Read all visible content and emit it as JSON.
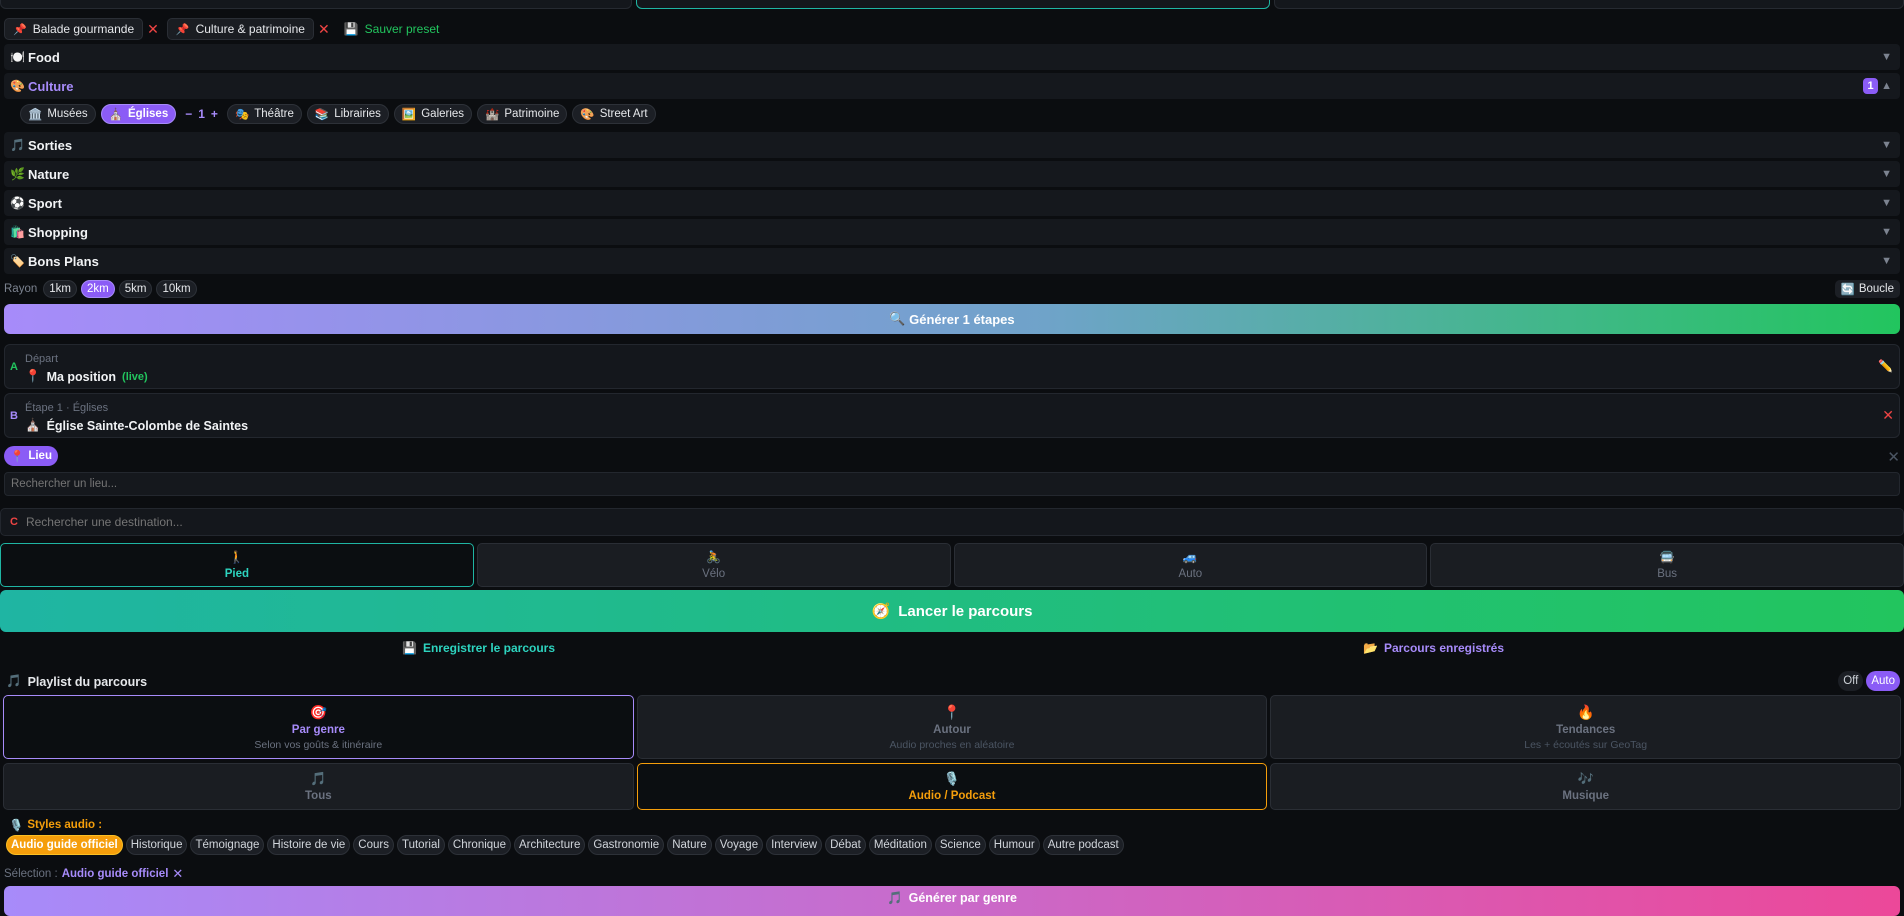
{
  "presets": {
    "items": [
      {
        "icon": "📌",
        "label": "Balade gourmande",
        "remove": "✕"
      },
      {
        "icon": "📌",
        "label": "Culture & patrimoine",
        "remove": "✕"
      }
    ],
    "save_icon": "💾",
    "save_label": "Sauver preset"
  },
  "categories": [
    {
      "icon": "🍽️",
      "label": "Food",
      "chevron": "▼"
    },
    {
      "icon": "🎨",
      "label": "Culture",
      "chevron": "▲",
      "count": "1"
    },
    {
      "icon": "🎵",
      "label": "Sorties",
      "chevron": "▼"
    },
    {
      "icon": "🌿",
      "label": "Nature",
      "chevron": "▼"
    },
    {
      "icon": "⚽",
      "label": "Sport",
      "chevron": "▼"
    },
    {
      "icon": "🛍️",
      "label": "Shopping",
      "chevron": "▼"
    },
    {
      "icon": "🏷️",
      "label": "Bons Plans",
      "chevron": "▼"
    }
  ],
  "subcategories": {
    "items": [
      {
        "icon": "🏛️",
        "label": "Musées"
      },
      {
        "icon": "⛪",
        "label": "Églises"
      },
      {
        "icon": "🎭",
        "label": "Théâtre"
      },
      {
        "icon": "📚",
        "label": "Librairies"
      },
      {
        "icon": "🖼️",
        "label": "Galeries"
      },
      {
        "icon": "🏰",
        "label": "Patrimoine"
      },
      {
        "icon": "🎨",
        "label": "Street Art"
      }
    ],
    "stepper": {
      "minus": "−",
      "value": "1",
      "plus": "+"
    }
  },
  "radius": {
    "label": "Rayon",
    "options": [
      "1km",
      "2km",
      "5km",
      "10km"
    ],
    "selected": "2km",
    "loop_icon": "🔄",
    "loop_label": "Boucle"
  },
  "generate": {
    "icon": "🔍",
    "label": "Générer 1 étapes"
  },
  "stops": {
    "a": {
      "letter": "A",
      "sublabel": "Départ",
      "icon": "📍",
      "title": "Ma position",
      "live": "(live)",
      "edit_icon": "✏️"
    },
    "b": {
      "letter": "B",
      "sublabel": "Étape 1 · Églises",
      "icon": "⛪",
      "title": "Église Sainte-Colombe de Saintes",
      "remove": "✕"
    }
  },
  "lieu": {
    "icon": "📍",
    "label": "Lieu",
    "close": "✕",
    "placeholder": "Rechercher un lieu..."
  },
  "destination": {
    "letter": "C",
    "placeholder": "Rechercher une destination..."
  },
  "transport": [
    {
      "icon": "🚶",
      "label": "Pied"
    },
    {
      "icon": "🚴",
      "label": "Vélo"
    },
    {
      "icon": "🚙",
      "label": "Auto"
    },
    {
      "icon": "🚍",
      "label": "Bus"
    }
  ],
  "launch": {
    "icon": "🧭",
    "label": "Lancer le parcours"
  },
  "route_actions": {
    "save_icon": "💾",
    "save_label": "Enregistrer le parcours",
    "saved_icon": "📂",
    "saved_label": "Parcours enregistrés"
  },
  "playlist": {
    "icon": "🎵",
    "title": "Playlist du parcours",
    "toggle": [
      "Off",
      "Auto"
    ],
    "modes": [
      {
        "icon": "🎯",
        "title": "Par genre",
        "subtitle": "Selon vos goûts & itinéraire"
      },
      {
        "icon": "📍",
        "title": "Autour",
        "subtitle": "Audio proches en aléatoire"
      },
      {
        "icon": "🔥",
        "title": "Tendances",
        "subtitle": "Les + écoutés sur GeoTag"
      }
    ],
    "types": [
      {
        "icon": "🎵",
        "label": "Tous"
      },
      {
        "icon": "🎙️",
        "label": "Audio / Podcast"
      },
      {
        "icon": "🎶",
        "label": "Musique"
      }
    ]
  },
  "audio_styles": {
    "icon": "🎙️",
    "title": "Styles audio :",
    "items": [
      "Audio guide officiel",
      "Historique",
      "Témoignage",
      "Histoire de vie",
      "Cours",
      "Tutorial",
      "Chronique",
      "Architecture",
      "Gastronomie",
      "Nature",
      "Voyage",
      "Interview",
      "Débat",
      "Méditation",
      "Science",
      "Humour",
      "Autre podcast"
    ],
    "selection_label": "Sélection :",
    "selection_value": "Audio guide officiel",
    "selection_clear": "✕"
  },
  "generate_genre": {
    "icon": "🎵",
    "label": "Générer par genre"
  },
  "colors": {
    "accent_purple": "#8b5cf6",
    "accent_teal": "#1fb5a3",
    "accent_green": "#22c55e",
    "accent_orange": "#f59e0b",
    "danger": "#ef4444"
  }
}
